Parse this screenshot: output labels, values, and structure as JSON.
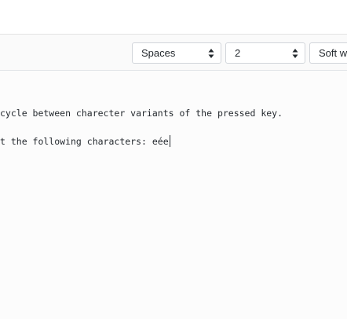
{
  "toolbar": {
    "indent_mode": {
      "value": "Spaces"
    },
    "indent_size": {
      "value": "2"
    },
    "wrap_mode": {
      "value": "Soft wrap"
    }
  },
  "editor": {
    "lines": [
      "cycle between charecter variants of the pressed key.",
      "t the following characters: eée"
    ],
    "cursor_line": 2
  }
}
